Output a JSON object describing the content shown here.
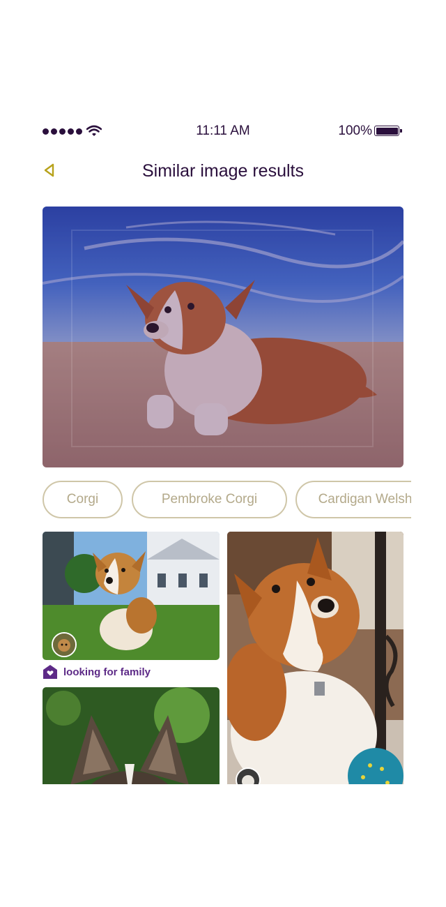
{
  "status_bar": {
    "time": "11:11 AM",
    "battery_percent": "100%",
    "signal_bars": 5
  },
  "header": {
    "title": "Similar image results",
    "back_icon": "chevron-left-icon"
  },
  "chips": [
    {
      "label": "Corgi"
    },
    {
      "label": "Pembroke Corgi"
    },
    {
      "label": "Cardigan Welsh"
    }
  ],
  "results": [
    {
      "id": "result-1",
      "tag": "looking for family",
      "tag_icon": "home-heart-icon"
    },
    {
      "id": "result-2"
    },
    {
      "id": "result-3"
    }
  ],
  "colors": {
    "accent": "#5d2a87",
    "text": "#2a0f3c",
    "chip_border": "#cfc6a8",
    "chip_text": "#b3a98a",
    "back_icon": "#b7a21b"
  }
}
